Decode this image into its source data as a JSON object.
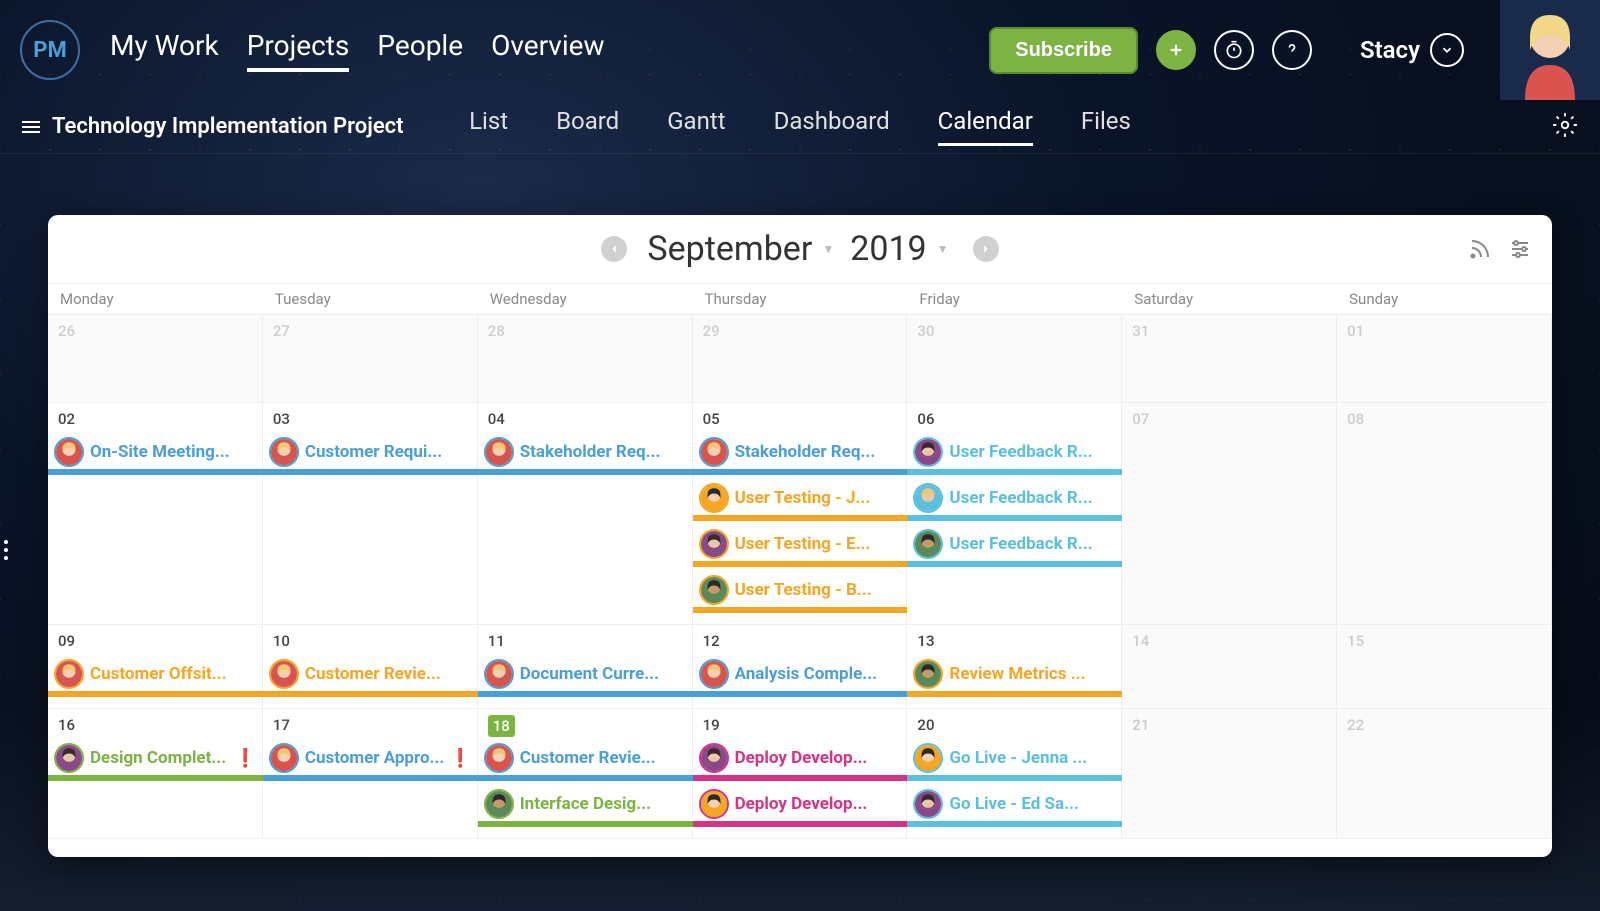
{
  "logo": "PM",
  "topnav": {
    "links": [
      "My Work",
      "Projects",
      "People",
      "Overview"
    ],
    "active": 1,
    "subscribe": "Subscribe",
    "user": "Stacy"
  },
  "project": "Technology Implementation Project",
  "views": {
    "tabs": [
      "List",
      "Board",
      "Gantt",
      "Dashboard",
      "Calendar",
      "Files"
    ],
    "active": 4
  },
  "calendar": {
    "month": "September",
    "year": "2019",
    "dayHeaders": [
      "Monday",
      "Tuesday",
      "Wednesday",
      "Thursday",
      "Friday",
      "Saturday",
      "Sunday"
    ],
    "weeks": [
      {
        "days": [
          {
            "n": "26",
            "muted": true
          },
          {
            "n": "27",
            "muted": true
          },
          {
            "n": "28",
            "muted": true
          },
          {
            "n": "29",
            "muted": true
          },
          {
            "n": "30",
            "muted": true
          },
          {
            "n": "31",
            "muted": true
          },
          {
            "n": "01",
            "muted": true
          }
        ],
        "rows": 0,
        "events": []
      },
      {
        "days": [
          {
            "n": "02"
          },
          {
            "n": "03"
          },
          {
            "n": "04"
          },
          {
            "n": "05"
          },
          {
            "n": "06"
          },
          {
            "n": "07",
            "muted": true
          },
          {
            "n": "08",
            "muted": true
          }
        ],
        "rows": 4,
        "events": [
          {
            "row": 0,
            "start": 0,
            "span": 1,
            "color": "blue",
            "label": "On-Site Meeting...",
            "avatar": "a1"
          },
          {
            "row": 0,
            "start": 1,
            "span": 1,
            "color": "blue",
            "label": "Customer Requi...",
            "avatar": "a1"
          },
          {
            "row": 0,
            "start": 2,
            "span": 1,
            "color": "blue",
            "label": "Stakeholder Req...",
            "avatar": "a1"
          },
          {
            "row": 0,
            "start": 3,
            "span": 1,
            "color": "blue",
            "label": "Stakeholder Req...",
            "avatar": "a1"
          },
          {
            "row": 0,
            "start": 4,
            "span": 1,
            "color": "sky",
            "label": "User Feedback R...",
            "avatar": "a2"
          },
          {
            "row": 1,
            "start": 3,
            "span": 1,
            "color": "orange",
            "label": "User Testing - J...",
            "avatar": "a3"
          },
          {
            "row": 1,
            "start": 4,
            "span": 1,
            "color": "sky",
            "label": "User Feedback R...",
            "avatar": "a4"
          },
          {
            "row": 2,
            "start": 3,
            "span": 1,
            "color": "orange",
            "label": "User Testing - E...",
            "avatar": "a2"
          },
          {
            "row": 2,
            "start": 4,
            "span": 1,
            "color": "sky",
            "label": "User Feedback R...",
            "avatar": "a5"
          },
          {
            "row": 3,
            "start": 3,
            "span": 1,
            "color": "orange",
            "label": "User Testing - B...",
            "avatar": "a5"
          }
        ]
      },
      {
        "days": [
          {
            "n": "09"
          },
          {
            "n": "10"
          },
          {
            "n": "11"
          },
          {
            "n": "12"
          },
          {
            "n": "13"
          },
          {
            "n": "14",
            "muted": true
          },
          {
            "n": "15",
            "muted": true
          }
        ],
        "rows": 1,
        "events": [
          {
            "row": 0,
            "start": 0,
            "span": 1,
            "color": "orange",
            "label": "Customer Offsit...",
            "avatar": "a1"
          },
          {
            "row": 0,
            "start": 1,
            "span": 1,
            "color": "orange",
            "label": "Customer Revie...",
            "avatar": "a1"
          },
          {
            "row": 0,
            "start": 2,
            "span": 1,
            "color": "blue",
            "label": "Document Curre...",
            "avatar": "a1"
          },
          {
            "row": 0,
            "start": 3,
            "span": 1,
            "color": "blue",
            "label": "Analysis Comple...",
            "avatar": "a1"
          },
          {
            "row": 0,
            "start": 4,
            "span": 1,
            "color": "orange",
            "label": "Review Metrics ...",
            "avatar": "a5"
          }
        ]
      },
      {
        "days": [
          {
            "n": "16"
          },
          {
            "n": "17"
          },
          {
            "n": "18",
            "today": true
          },
          {
            "n": "19"
          },
          {
            "n": "20"
          },
          {
            "n": "21",
            "muted": true
          },
          {
            "n": "22",
            "muted": true
          }
        ],
        "rows": 2,
        "events": [
          {
            "row": 0,
            "start": 0,
            "span": 1,
            "color": "green",
            "label": "Design Complet...",
            "avatar": "a2",
            "flag": true
          },
          {
            "row": 0,
            "start": 1,
            "span": 1,
            "color": "blue",
            "label": "Customer Appro...",
            "avatar": "a1",
            "flag": true
          },
          {
            "row": 0,
            "start": 2,
            "span": 1,
            "color": "blue",
            "label": "Customer Revie...",
            "avatar": "a1"
          },
          {
            "row": 0,
            "start": 3,
            "span": 1,
            "color": "pink",
            "label": "Deploy Develop...",
            "avatar": "a2"
          },
          {
            "row": 0,
            "start": 4,
            "span": 1,
            "color": "sky",
            "label": "Go Live - Jenna ...",
            "avatar": "a3"
          },
          {
            "row": 1,
            "start": 2,
            "span": 1,
            "color": "green",
            "label": "Interface Desig...",
            "avatar": "a5"
          },
          {
            "row": 1,
            "start": 3,
            "span": 1,
            "color": "pink",
            "label": "Deploy Develop...",
            "avatar": "a3"
          },
          {
            "row": 1,
            "start": 4,
            "span": 1,
            "color": "sky",
            "label": "Go Live - Ed Sa...",
            "avatar": "a2"
          }
        ]
      }
    ]
  },
  "avatars": {
    "a1": {
      "bg": "#f4d0b5",
      "hair": "#f0c674",
      "shirt": "#d9534f"
    },
    "a2": {
      "bg": "#e8c8a8",
      "hair": "#3a2a2a",
      "shirt": "#8a4a8a"
    },
    "a3": {
      "bg": "#f4d0b5",
      "hair": "#2a2a2a",
      "shirt": "#f5a623"
    },
    "a4": {
      "bg": "#e8c8a8",
      "hair": "#f0c674",
      "shirt": "#5bc0de"
    },
    "a5": {
      "bg": "#c89a6a",
      "hair": "#2a2a2a",
      "shirt": "#5a8a5a"
    }
  }
}
